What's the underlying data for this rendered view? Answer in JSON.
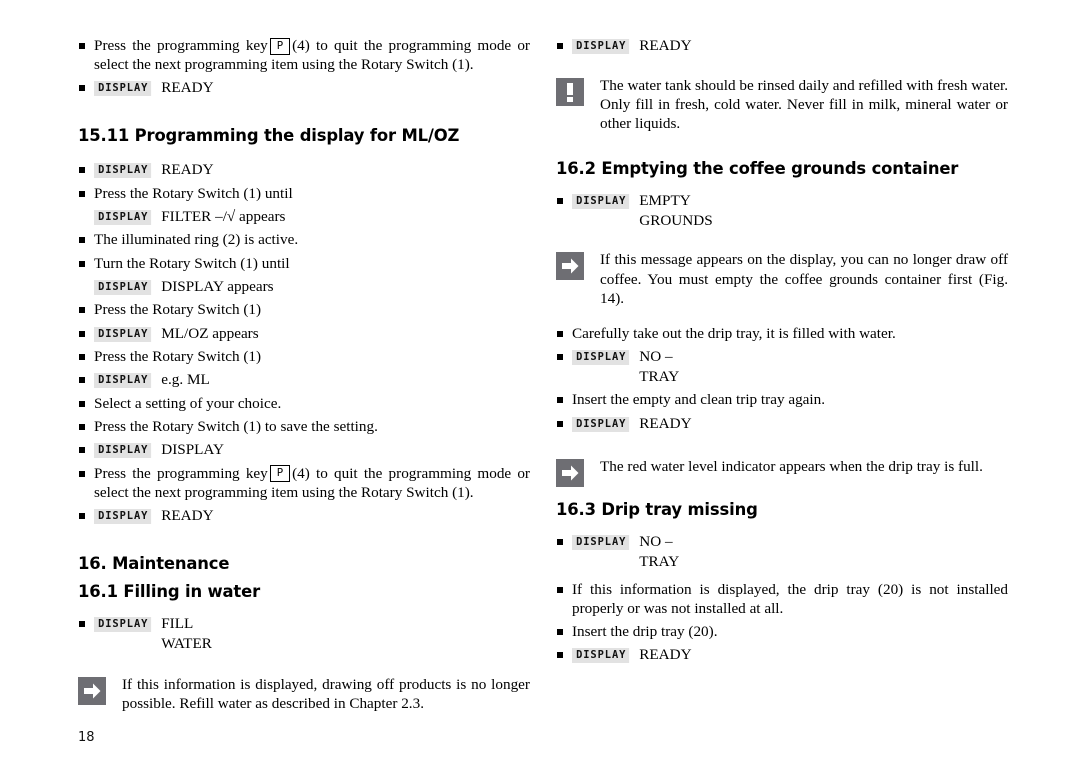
{
  "page": {
    "number": "18",
    "icons": {
      "bullet": "square-bullet",
      "display_badge": "display-badge",
      "arrow": "arrow-right-icon",
      "warning": "exclamation-icon",
      "keycap": "p-key-icon"
    },
    "colors": {
      "icon_box": "#6e6e73",
      "badge_bg": "#e2e2e2",
      "text": "#000000"
    }
  },
  "badge_label": "DISPLAY",
  "keycap_label": "P",
  "left_column": {
    "item_quit_programming": {
      "text": "Press the programming key",
      "text_after_key": "(4) to quit the programming mode or select the next programming item using the Rotary Switch (1)."
    },
    "display_ready_1": "READY",
    "heading_15_11": "15.11 Programming the display for ML/OZ",
    "display_ready_2": "READY",
    "item_press_until": "Press the Rotary Switch (1) until",
    "display_filter": "FILTER –/√ appears",
    "item_illuminated_ring": "The illuminated ring (2) is active.",
    "item_turn_until": "Turn the Rotary Switch (1) until",
    "display_display_appears": "DISPLAY appears",
    "item_press_rotary_1": "Press the Rotary Switch (1)",
    "display_mloz": "ML/OZ appears",
    "item_press_rotary_2": "Press the Rotary Switch (1)",
    "display_eg_ml": "e.g. ML",
    "item_select_setting": "Select a setting of your choice.",
    "item_press_save": "Press the Rotary Switch (1) to save the setting.",
    "display_display": "DISPLAY",
    "item_quit_programming_2": {
      "text": "Press the programming key",
      "text_after_key": "(4) to quit the programming mode or select the next programming item using the Rotary Switch (1)."
    },
    "display_ready_3": "READY",
    "heading_16": "16. Maintenance",
    "heading_16_1": "16.1 Filling in water",
    "display_fill_water": "FILL\nWATER",
    "note_refill": "If this information is displayed, drawing off products is no longer possible. Refill water as described in Chapter 2.3."
  },
  "right_column": {
    "display_ready_1": "READY",
    "note_water_tank": "The water tank should be rinsed daily and refilled with fresh water. Only fill in fresh, cold water. Never fill in milk, mineral water or other liquids.",
    "heading_16_2": "16.2 Emptying the coffee grounds container",
    "display_empty_grounds": "EMPTY\nGROUNDS",
    "note_empty_container": "If this message appears on the display, you can no longer draw off coffee. You must empty the coffee grounds container first (Fig. 14).",
    "item_take_out_tray": "Carefully take out the drip tray, it is filled with water.",
    "display_no_tray_1": "NO –\nTRAY",
    "item_insert_empty": "Insert the empty and clean trip tray again.",
    "display_ready_2": "READY",
    "note_red_indicator": "The red water level indicator appears when the drip tray is full.",
    "heading_16_3": "16.3 Drip tray missing",
    "display_no_tray_2": "NO –\nTRAY",
    "item_not_installed": "If this information is displayed, the drip tray (20)  is not installed properly or was not installed at all.",
    "item_insert_tray": "Insert the drip tray (20).",
    "display_ready_3": "READY"
  }
}
